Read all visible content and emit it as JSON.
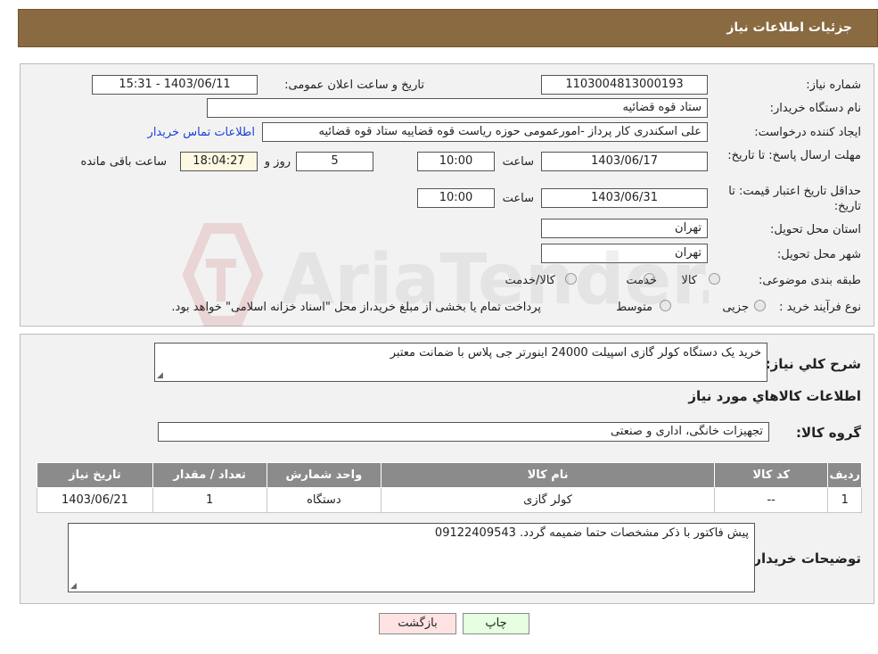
{
  "header": {
    "title": "جزئیات اطلاعات نیاز"
  },
  "fields": {
    "need_number_label": "شماره نیاز:",
    "need_number": "1103004813000193",
    "announce_label": "تاریخ و ساعت اعلان عمومی:",
    "announce_value": "1403/06/11 - 15:31",
    "buyer_org_label": "نام دستگاه خریدار:",
    "buyer_org": "ستاد قوه قضائیه",
    "requester_label": "ایجاد کننده درخواست:",
    "requester": "علی اسکندری کار پرداز -امورعمومی حوزه ریاست قوه قضاییه ستاد قوه قضائیه",
    "buyer_contact_link": "اطلاعات تماس خریدار",
    "deadline_label": "مهلت ارسال پاسخ: تا تاریخ:",
    "deadline_date": "1403/06/17",
    "time_label": "ساعت",
    "deadline_time": "10:00",
    "days_value": "5",
    "days_label": "روز و",
    "remaining_value": "18:04:27",
    "remaining_label": "ساعت باقی مانده",
    "min_validity_label": "حداقل تاریخ اعتبار قیمت: تا تاریخ:",
    "validity_date": "1403/06/31",
    "validity_time": "10:00",
    "province_label": "استان محل تحویل:",
    "province": "تهران",
    "city_label": "شهر محل تحویل:",
    "city": "تهران",
    "category_label": "طبقه بندی موضوعی:",
    "category_options": [
      "کالا",
      "خدمت",
      "کالا/خدمت"
    ],
    "process_label": "نوع فرآیند خرید :",
    "process_options": [
      "جزیی",
      "متوسط"
    ],
    "process_note": "پرداخت تمام یا بخشی از مبلغ خرید،از محل \"اسناد خزانه اسلامی\" خواهد بود."
  },
  "details": {
    "summary_label": "شرح کلي نياز:",
    "summary_text": "خرید یک دستگاه کولر گازی اسپیلت 24000 اینورتر جی پلاس  با ضمانت معتبر",
    "goods_info_title": "اطلاعات کالاهاي مورد نياز",
    "goods_group_label": "گروه کالا:",
    "goods_group": "تجهیزات خانگی، اداری و صنعتی",
    "table": {
      "headers": [
        "رديف",
        "کد کالا",
        "نام کالا",
        "واحد شمارش",
        "تعداد / مقدار",
        "تاریخ نیاز"
      ],
      "rows": [
        [
          "1",
          "--",
          "کولر گازی",
          "دستگاه",
          "1",
          "1403/06/21"
        ]
      ]
    },
    "buyer_notes_label": "توضیحات خریدار:",
    "buyer_notes": "پیش فاکتور با ذکر مشخصات حتما ضمیمه گردد. 09122409543"
  },
  "buttons": {
    "print": "چاپ",
    "back": "بازگشت"
  },
  "watermark_text": "AriaTender.neT",
  "colors": {
    "header": "#8a6a40",
    "table_header": "#8b8b8b",
    "link": "#1a3fd6"
  }
}
